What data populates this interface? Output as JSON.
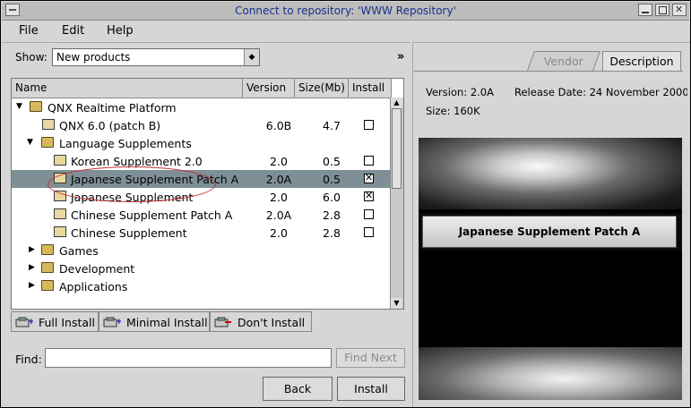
{
  "window": {
    "title": "Connect to repository: 'WWW Repository'"
  },
  "menu": [
    "File",
    "Edit",
    "Help"
  ],
  "filter": {
    "label": "Show:",
    "value": "New products"
  },
  "tree": {
    "columns": [
      "Name",
      "Version",
      "Size(Mb)",
      "Install"
    ],
    "rows": [
      {
        "name": "QNX Realtime Platform",
        "version": "",
        "size": "",
        "install": null
      },
      {
        "name": "QNX 6.0 (patch B)",
        "version": "6.0B",
        "size": "4.7",
        "install": false
      },
      {
        "name": "Language Supplements",
        "version": "",
        "size": "",
        "install": null
      },
      {
        "name": "Korean Supplement 2.0",
        "version": "2.0",
        "size": "0.5",
        "install": false
      },
      {
        "name": "Japanese Supplement Patch A",
        "version": "2.0A",
        "size": "0.5",
        "install": true
      },
      {
        "name": "Japanese Supplement",
        "version": "2.0",
        "size": "6.0",
        "install": true
      },
      {
        "name": "Chinese Supplement Patch A",
        "version": "2.0A",
        "size": "2.8",
        "install": false
      },
      {
        "name": "Chinese Supplement",
        "version": "2.0",
        "size": "2.8",
        "install": false
      },
      {
        "name": "Games",
        "version": "",
        "size": "",
        "install": null
      },
      {
        "name": "Development",
        "version": "",
        "size": "",
        "install": null
      },
      {
        "name": "Applications",
        "version": "",
        "size": "",
        "install": null
      }
    ]
  },
  "install_buttons": {
    "full": "Full Install",
    "minimal": "Minimal Install",
    "dont": "Don't Install"
  },
  "find": {
    "label": "Find:",
    "value": "",
    "next_label": "Find Next"
  },
  "actions": {
    "back": "Back",
    "install": "Install"
  },
  "tabs": {
    "vendor": "Vendor",
    "description": "Description"
  },
  "details": {
    "version": "Version: 2.0A",
    "release": "Release Date: 24 November 2000",
    "size": "Size: 160K",
    "banner": "Japanese Supplement Patch A"
  }
}
